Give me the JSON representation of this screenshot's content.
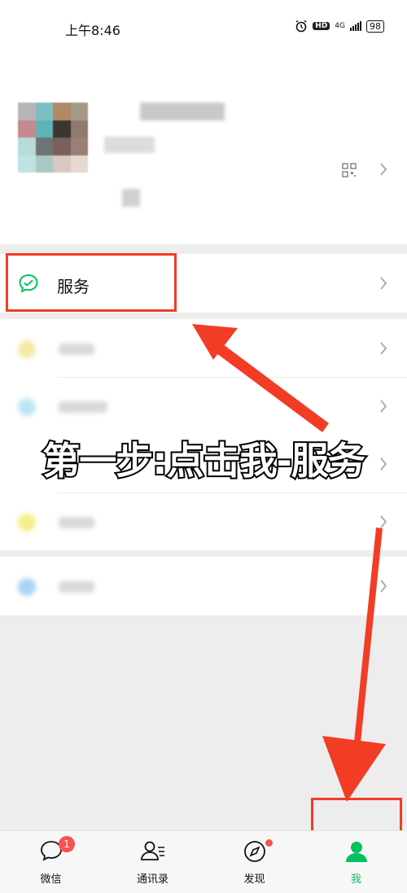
{
  "status_bar": {
    "time": "上午8:46",
    "hd": "HD",
    "network": "4G",
    "battery": "98"
  },
  "menu": {
    "service_label": "服务"
  },
  "caption": "第一步:点击我-服务",
  "tabs": [
    {
      "label": "微信",
      "badge": "1",
      "icon": "chat-icon"
    },
    {
      "label": "通讯录",
      "icon": "contacts-icon"
    },
    {
      "label": "发现",
      "icon": "compass-icon"
    },
    {
      "label": "我",
      "icon": "person-icon"
    }
  ],
  "colors": {
    "accent_green": "#07c160",
    "highlight_red": "#f23c25",
    "badge_red": "#fa5151"
  }
}
